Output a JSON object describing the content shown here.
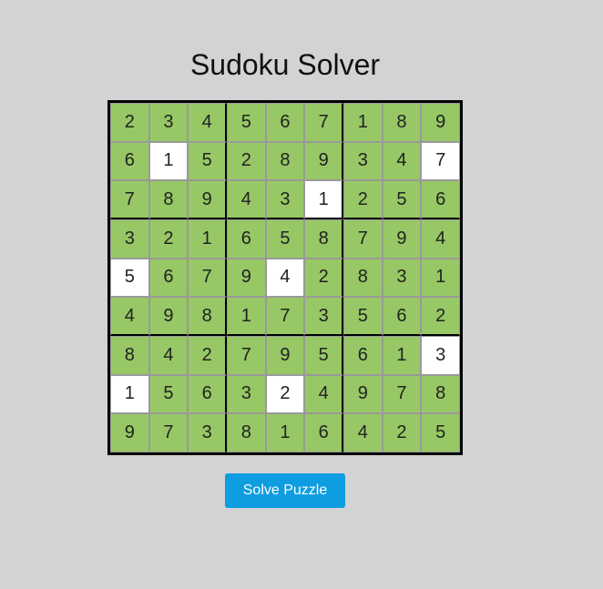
{
  "title": "Sudoku Solver",
  "button": {
    "label": "Solve Puzzle"
  },
  "colors": {
    "solved_cell": "#97c865",
    "input_cell": "#ffffff",
    "button": "#0d9de0",
    "background": "#d3d3d3"
  },
  "grid": [
    [
      "2",
      "3",
      "4",
      "5",
      "6",
      "7",
      "1",
      "8",
      "9"
    ],
    [
      "6",
      "1",
      "5",
      "2",
      "8",
      "9",
      "3",
      "4",
      "7"
    ],
    [
      "7",
      "8",
      "9",
      "4",
      "3",
      "1",
      "2",
      "5",
      "6"
    ],
    [
      "3",
      "2",
      "1",
      "6",
      "5",
      "8",
      "7",
      "9",
      "4"
    ],
    [
      "5",
      "6",
      "7",
      "9",
      "4",
      "2",
      "8",
      "3",
      "1"
    ],
    [
      "4",
      "9",
      "8",
      "1",
      "7",
      "3",
      "5",
      "6",
      "2"
    ],
    [
      "8",
      "4",
      "2",
      "7",
      "9",
      "5",
      "6",
      "1",
      "3"
    ],
    [
      "1",
      "5",
      "6",
      "3",
      "2",
      "4",
      "9",
      "7",
      "8"
    ],
    [
      "9",
      "7",
      "3",
      "8",
      "1",
      "6",
      "4",
      "2",
      "5"
    ]
  ],
  "white_cells": [
    [
      1,
      1
    ],
    [
      1,
      8
    ],
    [
      2,
      5
    ],
    [
      4,
      0
    ],
    [
      4,
      4
    ],
    [
      6,
      8
    ],
    [
      7,
      0
    ],
    [
      7,
      4
    ]
  ]
}
